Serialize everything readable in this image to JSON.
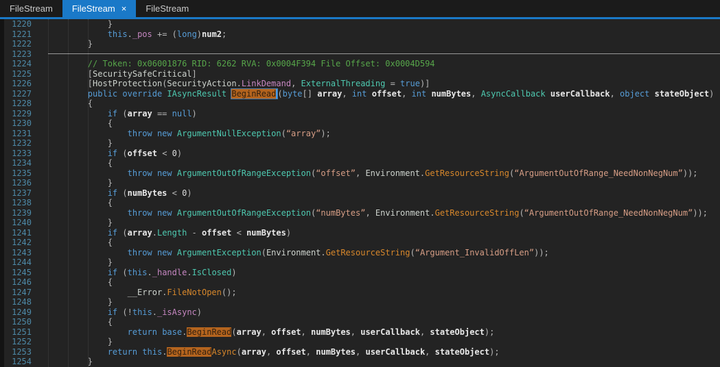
{
  "window": {
    "app": "decompiler-code-view"
  },
  "colors": {
    "accent_blue": "#1a79c8",
    "editor_background": "#232323",
    "line_number": "#4e8aa8",
    "keyword": "#569cd6",
    "type": "#4ec9b0",
    "field": "#c586c0",
    "method": "#d7872b",
    "string": "#d69d85",
    "comment": "#57a64a",
    "highlight_background": "#b4641e"
  },
  "tabs": [
    {
      "label": "FileStream",
      "active": false,
      "close": ""
    },
    {
      "label": "FileStream",
      "active": true,
      "close": "×"
    },
    {
      "label": "FileStream",
      "active": false,
      "close": ""
    }
  ],
  "editor": {
    "first_line_number": 1220,
    "last_line_number": 1254,
    "lines": [
      {
        "n": 1220,
        "seg": [
          [
            "            }",
            "o"
          ]
        ]
      },
      {
        "n": 1221,
        "seg": [
          [
            "            ",
            "o"
          ],
          [
            "this",
            "k"
          ],
          [
            ".",
            "o"
          ],
          [
            "_pos",
            "f"
          ],
          [
            " ",
            "o"
          ],
          [
            "+=",
            "o"
          ],
          [
            " (",
            "o"
          ],
          [
            "long",
            "k"
          ],
          [
            ")",
            "o"
          ],
          [
            "num2",
            "p"
          ],
          [
            ";",
            "o"
          ]
        ]
      },
      {
        "n": 1222,
        "seg": [
          [
            "        }",
            "o"
          ]
        ]
      },
      {
        "n": 1223,
        "seg": [],
        "sep": true
      },
      {
        "n": 1224,
        "seg": [
          [
            "        ",
            "o"
          ],
          [
            "// Token: 0x06001876 RID: 6262 RVA: 0x0004F394 File Offset: 0x0004D594",
            "c"
          ]
        ]
      },
      {
        "n": 1225,
        "seg": [
          [
            "        [",
            "o"
          ],
          [
            "SecuritySafeCritical",
            "g"
          ],
          [
            "]",
            "o"
          ]
        ]
      },
      {
        "n": 1226,
        "seg": [
          [
            "        [",
            "o"
          ],
          [
            "HostProtection",
            "g"
          ],
          [
            "(",
            "o"
          ],
          [
            "SecurityAction",
            "g"
          ],
          [
            ".",
            "o"
          ],
          [
            "LinkDemand",
            "f"
          ],
          [
            ", ",
            "o"
          ],
          [
            "ExternalThreading",
            "t"
          ],
          [
            " = ",
            "o"
          ],
          [
            "true",
            "k"
          ],
          [
            ")]",
            "o"
          ]
        ]
      },
      {
        "n": 1227,
        "seg": [
          [
            "        ",
            "o"
          ],
          [
            "public",
            "k"
          ],
          [
            " ",
            "o"
          ],
          [
            "override",
            "k"
          ],
          [
            " ",
            "o"
          ],
          [
            "IAsyncResult",
            "t"
          ],
          [
            " ",
            "o"
          ],
          [
            "BeginRead",
            "hc"
          ],
          [
            "(",
            "o"
          ],
          [
            "byte",
            "k"
          ],
          [
            "[] ",
            "o"
          ],
          [
            "array",
            "p"
          ],
          [
            ", ",
            "o"
          ],
          [
            "int",
            "k"
          ],
          [
            " ",
            "o"
          ],
          [
            "offset",
            "p"
          ],
          [
            ", ",
            "o"
          ],
          [
            "int",
            "k"
          ],
          [
            " ",
            "o"
          ],
          [
            "numBytes",
            "p"
          ],
          [
            ", ",
            "o"
          ],
          [
            "AsyncCallback",
            "t"
          ],
          [
            " ",
            "o"
          ],
          [
            "userCallback",
            "p"
          ],
          [
            ", ",
            "o"
          ],
          [
            "object",
            "k"
          ],
          [
            " ",
            "o"
          ],
          [
            "stateObject",
            "p"
          ],
          [
            ")",
            "o"
          ]
        ]
      },
      {
        "n": 1228,
        "seg": [
          [
            "        {",
            "o"
          ]
        ]
      },
      {
        "n": 1229,
        "seg": [
          [
            "            ",
            "o"
          ],
          [
            "if",
            "k"
          ],
          [
            " (",
            "o"
          ],
          [
            "array",
            "p"
          ],
          [
            " == ",
            "o"
          ],
          [
            "null",
            "k"
          ],
          [
            ")",
            "o"
          ]
        ]
      },
      {
        "n": 1230,
        "seg": [
          [
            "            {",
            "o"
          ]
        ]
      },
      {
        "n": 1231,
        "seg": [
          [
            "                ",
            "o"
          ],
          [
            "throw",
            "k"
          ],
          [
            " ",
            "o"
          ],
          [
            "new",
            "k"
          ],
          [
            " ",
            "o"
          ],
          [
            "ArgumentNullException",
            "t"
          ],
          [
            "(",
            "o"
          ],
          [
            "“array”",
            "s"
          ],
          [
            ");",
            "o"
          ]
        ]
      },
      {
        "n": 1232,
        "seg": [
          [
            "            }",
            "o"
          ]
        ]
      },
      {
        "n": 1233,
        "seg": [
          [
            "            ",
            "o"
          ],
          [
            "if",
            "k"
          ],
          [
            " (",
            "o"
          ],
          [
            "offset",
            "p"
          ],
          [
            " < ",
            "o"
          ],
          [
            "0",
            "w"
          ],
          [
            ")",
            "o"
          ]
        ]
      },
      {
        "n": 1234,
        "seg": [
          [
            "            {",
            "o"
          ]
        ]
      },
      {
        "n": 1235,
        "seg": [
          [
            "                ",
            "o"
          ],
          [
            "throw",
            "k"
          ],
          [
            " ",
            "o"
          ],
          [
            "new",
            "k"
          ],
          [
            " ",
            "o"
          ],
          [
            "ArgumentOutOfRangeException",
            "t"
          ],
          [
            "(",
            "o"
          ],
          [
            "“offset”",
            "s"
          ],
          [
            ", ",
            "o"
          ],
          [
            "Environment",
            "g"
          ],
          [
            ".",
            "o"
          ],
          [
            "GetResourceString",
            "m"
          ],
          [
            "(",
            "o"
          ],
          [
            "“ArgumentOutOfRange_NeedNonNegNum”",
            "s"
          ],
          [
            "));",
            "o"
          ]
        ]
      },
      {
        "n": 1236,
        "seg": [
          [
            "            }",
            "o"
          ]
        ]
      },
      {
        "n": 1237,
        "seg": [
          [
            "            ",
            "o"
          ],
          [
            "if",
            "k"
          ],
          [
            " (",
            "o"
          ],
          [
            "numBytes",
            "p"
          ],
          [
            " < ",
            "o"
          ],
          [
            "0",
            "w"
          ],
          [
            ")",
            "o"
          ]
        ]
      },
      {
        "n": 1238,
        "seg": [
          [
            "            {",
            "o"
          ]
        ]
      },
      {
        "n": 1239,
        "seg": [
          [
            "                ",
            "o"
          ],
          [
            "throw",
            "k"
          ],
          [
            " ",
            "o"
          ],
          [
            "new",
            "k"
          ],
          [
            " ",
            "o"
          ],
          [
            "ArgumentOutOfRangeException",
            "t"
          ],
          [
            "(",
            "o"
          ],
          [
            "“numBytes”",
            "s"
          ],
          [
            ", ",
            "o"
          ],
          [
            "Environment",
            "g"
          ],
          [
            ".",
            "o"
          ],
          [
            "GetResourceString",
            "m"
          ],
          [
            "(",
            "o"
          ],
          [
            "“ArgumentOutOfRange_NeedNonNegNum”",
            "s"
          ],
          [
            "));",
            "o"
          ]
        ]
      },
      {
        "n": 1240,
        "seg": [
          [
            "            }",
            "o"
          ]
        ]
      },
      {
        "n": 1241,
        "seg": [
          [
            "            ",
            "o"
          ],
          [
            "if",
            "k"
          ],
          [
            " (",
            "o"
          ],
          [
            "array",
            "p"
          ],
          [
            ".",
            "o"
          ],
          [
            "Length",
            "t"
          ],
          [
            " - ",
            "o"
          ],
          [
            "offset",
            "p"
          ],
          [
            " < ",
            "o"
          ],
          [
            "numBytes",
            "p"
          ],
          [
            ")",
            "o"
          ]
        ]
      },
      {
        "n": 1242,
        "seg": [
          [
            "            {",
            "o"
          ]
        ]
      },
      {
        "n": 1243,
        "seg": [
          [
            "                ",
            "o"
          ],
          [
            "throw",
            "k"
          ],
          [
            " ",
            "o"
          ],
          [
            "new",
            "k"
          ],
          [
            " ",
            "o"
          ],
          [
            "ArgumentException",
            "t"
          ],
          [
            "(",
            "o"
          ],
          [
            "Environment",
            "g"
          ],
          [
            ".",
            "o"
          ],
          [
            "GetResourceString",
            "m"
          ],
          [
            "(",
            "o"
          ],
          [
            "“Argument_InvalidOffLen”",
            "s"
          ],
          [
            "));",
            "o"
          ]
        ]
      },
      {
        "n": 1244,
        "seg": [
          [
            "            }",
            "o"
          ]
        ]
      },
      {
        "n": 1245,
        "seg": [
          [
            "            ",
            "o"
          ],
          [
            "if",
            "k"
          ],
          [
            " (",
            "o"
          ],
          [
            "this",
            "k"
          ],
          [
            ".",
            "o"
          ],
          [
            "_handle",
            "f"
          ],
          [
            ".",
            "o"
          ],
          [
            "IsClosed",
            "t"
          ],
          [
            ")",
            "o"
          ]
        ]
      },
      {
        "n": 1246,
        "seg": [
          [
            "            {",
            "o"
          ]
        ]
      },
      {
        "n": 1247,
        "seg": [
          [
            "                ",
            "o"
          ],
          [
            "__Error",
            "g"
          ],
          [
            ".",
            "o"
          ],
          [
            "FileNotOpen",
            "m"
          ],
          [
            "();",
            "o"
          ]
        ]
      },
      {
        "n": 1248,
        "seg": [
          [
            "            }",
            "o"
          ]
        ]
      },
      {
        "n": 1249,
        "seg": [
          [
            "            ",
            "o"
          ],
          [
            "if",
            "k"
          ],
          [
            " (!",
            "o"
          ],
          [
            "this",
            "k"
          ],
          [
            ".",
            "o"
          ],
          [
            "_isAsync",
            "f"
          ],
          [
            ")",
            "o"
          ]
        ]
      },
      {
        "n": 1250,
        "seg": [
          [
            "            {",
            "o"
          ]
        ]
      },
      {
        "n": 1251,
        "seg": [
          [
            "                ",
            "o"
          ],
          [
            "return",
            "k"
          ],
          [
            " ",
            "o"
          ],
          [
            "base",
            "k"
          ],
          [
            ".",
            "o"
          ],
          [
            "BeginRead",
            "h"
          ],
          [
            "(",
            "o"
          ],
          [
            "array",
            "p"
          ],
          [
            ", ",
            "o"
          ],
          [
            "offset",
            "p"
          ],
          [
            ", ",
            "o"
          ],
          [
            "numBytes",
            "p"
          ],
          [
            ", ",
            "o"
          ],
          [
            "userCallback",
            "p"
          ],
          [
            ", ",
            "o"
          ],
          [
            "stateObject",
            "p"
          ],
          [
            ");",
            "o"
          ]
        ]
      },
      {
        "n": 1252,
        "seg": [
          [
            "            }",
            "o"
          ]
        ]
      },
      {
        "n": 1253,
        "seg": [
          [
            "            ",
            "o"
          ],
          [
            "return",
            "k"
          ],
          [
            " ",
            "o"
          ],
          [
            "this",
            "k"
          ],
          [
            ".",
            "o"
          ],
          [
            "BeginRead",
            "h"
          ],
          [
            "Async",
            "m"
          ],
          [
            "(",
            "o"
          ],
          [
            "array",
            "p"
          ],
          [
            ", ",
            "o"
          ],
          [
            "offset",
            "p"
          ],
          [
            ", ",
            "o"
          ],
          [
            "numBytes",
            "p"
          ],
          [
            ", ",
            "o"
          ],
          [
            "userCallback",
            "p"
          ],
          [
            ", ",
            "o"
          ],
          [
            "stateObject",
            "p"
          ],
          [
            ");",
            "o"
          ]
        ]
      },
      {
        "n": 1254,
        "seg": [
          [
            "        }",
            "o"
          ]
        ]
      }
    ]
  }
}
